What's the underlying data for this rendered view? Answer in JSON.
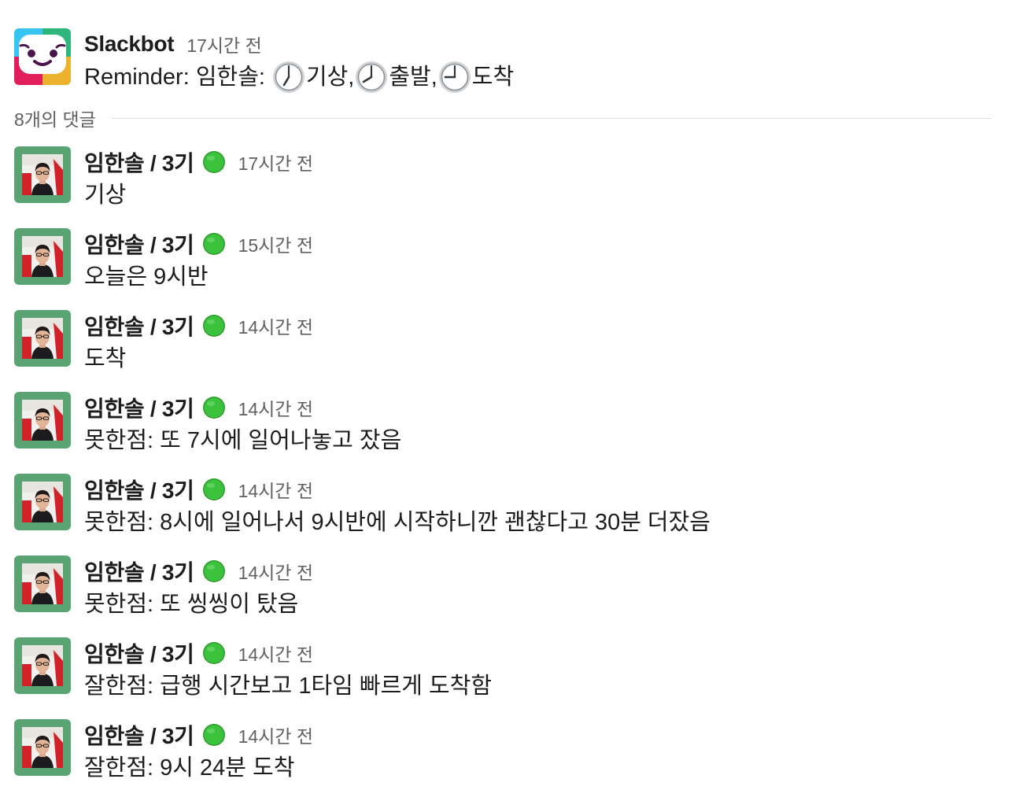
{
  "parent": {
    "sender": "Slackbot",
    "time": "17시간 전",
    "text_prefix": "Reminder: 임한솔:",
    "items": [
      {
        "icon": "clock-7-icon",
        "label": " 기상,"
      },
      {
        "icon": "clock-8-icon",
        "label": " 출발,"
      },
      {
        "icon": "clock-9-icon",
        "label": "도착"
      }
    ]
  },
  "thread": {
    "reply_count_label": "8개의 댓글"
  },
  "replies": [
    {
      "sender": "임한솔 / 3기",
      "time": "17시간 전",
      "text": "기상"
    },
    {
      "sender": "임한솔 / 3기",
      "time": "15시간 전",
      "text": "오늘은 9시반"
    },
    {
      "sender": "임한솔 / 3기",
      "time": "14시간 전",
      "text": "도착"
    },
    {
      "sender": "임한솔 / 3기",
      "time": "14시간 전",
      "text": "못한점: 또 7시에 일어나놓고 잤음"
    },
    {
      "sender": "임한솔 / 3기",
      "time": "14시간 전",
      "text": "못한점: 8시에 일어나서 9시반에 시작하니깐 괜찮다고 30분 더잤음"
    },
    {
      "sender": "임한솔 / 3기",
      "time": "14시간 전",
      "text": "못한점: 또 씽씽이 탔음"
    },
    {
      "sender": "임한솔 / 3기",
      "time": "14시간 전",
      "text": "잘한점: 급행 시간보고 1타임 빠르게 도착함"
    },
    {
      "sender": "임한솔 / 3기",
      "time": "14시간 전",
      "text": "잘한점: 9시 24분 도착"
    }
  ],
  "colors": {
    "avatar_frame": "#5aa474",
    "status_green": "#2eb82e",
    "timestamp": "#616061"
  }
}
